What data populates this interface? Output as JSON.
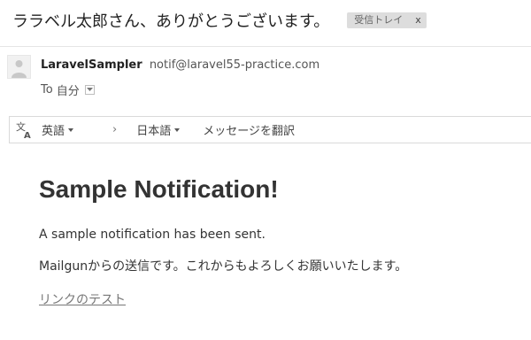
{
  "subject": "ララベル太郎さん、ありがとうございます。",
  "label": {
    "text": "受信トレイ",
    "close": "x"
  },
  "sender": {
    "name": "LaravelSampler",
    "email": "notif@laravel55-practice.com"
  },
  "recipient": {
    "prefix": "To",
    "value": "自分"
  },
  "translate": {
    "source_lang": "英語",
    "arrow": "›",
    "target_lang": "日本語",
    "action": "メッセージを翻訳"
  },
  "message": {
    "title": "Sample Notification!",
    "line1": "A sample notification has been sent.",
    "line2": "Mailgunからの送信です。これからもよろしくお願いいたします。",
    "link": "リンクのテスト"
  },
  "colors": {
    "chip_bg": "#dddddd",
    "link": "#777777",
    "border": "#dadada"
  },
  "icons": [
    "avatar-icon",
    "dropdown-icon",
    "translate-icon",
    "caret-icon"
  ]
}
